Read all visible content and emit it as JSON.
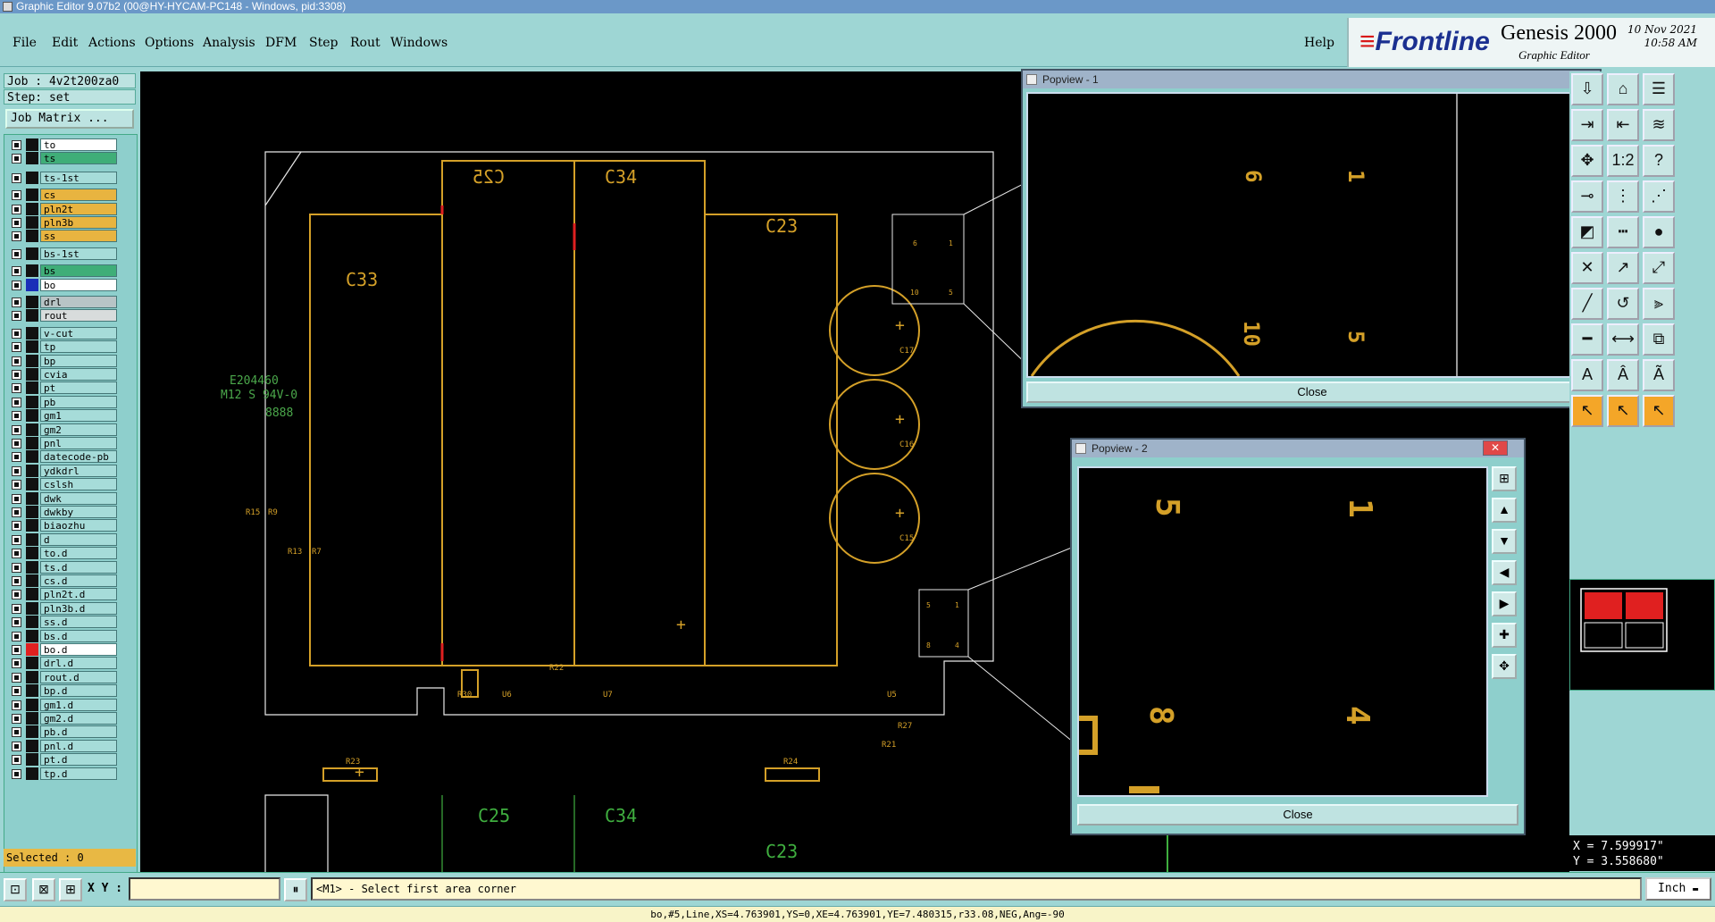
{
  "window_title": "Graphic Editor 9.07b2 (00@HY-HYCAM-PC148 - Windows, pid:3308)",
  "menu": [
    "File",
    "Edit",
    "Actions",
    "Options",
    "Analysis",
    "DFM",
    "Step",
    "Rout",
    "Windows"
  ],
  "help": "Help",
  "brand": {
    "logo": "Frontline",
    "product": "Genesis 2000",
    "subtitle": "Graphic Editor",
    "date": "10 Nov 2021",
    "time": "10:58 AM"
  },
  "job": {
    "job_line": "Job : 4v2t200za0",
    "step_line": "Step: set",
    "matrix_button": "Job Matrix ..."
  },
  "layers": [
    {
      "name": "to",
      "color": "#ffffff"
    },
    {
      "name": "ts",
      "color": "#3fae78"
    },
    {
      "name": "ts-1st",
      "color": "#a6dcd9"
    },
    {
      "name": "cs",
      "color": "#e8b440"
    },
    {
      "name": "pln2t",
      "color": "#e8b440"
    },
    {
      "name": "pln3b",
      "color": "#e8b440"
    },
    {
      "name": "ss",
      "color": "#e8b440"
    },
    {
      "name": "bs-1st",
      "color": "#a6dcd9"
    },
    {
      "name": "bs",
      "color": "#3fae78"
    },
    {
      "name": "bo",
      "color": "#ffffff"
    },
    {
      "name": "drl",
      "color": "#b8c4c6"
    },
    {
      "name": "rout",
      "color": "#d8dcdc"
    },
    {
      "name": "v-cut",
      "color": "#a6dcd9"
    },
    {
      "name": "tp",
      "color": "#a6dcd9"
    },
    {
      "name": "bp",
      "color": "#a6dcd9"
    },
    {
      "name": "cvia",
      "color": "#a6dcd9"
    },
    {
      "name": "pt",
      "color": "#a6dcd9"
    },
    {
      "name": "pb",
      "color": "#a6dcd9"
    },
    {
      "name": "gm1",
      "color": "#a6dcd9"
    },
    {
      "name": "gm2",
      "color": "#a6dcd9"
    },
    {
      "name": "pnl",
      "color": "#a6dcd9"
    },
    {
      "name": "datecode-pb",
      "color": "#a6dcd9"
    },
    {
      "name": "ydkdrl",
      "color": "#a6dcd9"
    },
    {
      "name": "cslsh",
      "color": "#a6dcd9"
    },
    {
      "name": "dwk",
      "color": "#a6dcd9"
    },
    {
      "name": "dwkby",
      "color": "#a6dcd9"
    },
    {
      "name": "biaozhu",
      "color": "#a6dcd9"
    },
    {
      "name": "d",
      "color": "#a6dcd9"
    },
    {
      "name": "to.d",
      "color": "#a6dcd9"
    },
    {
      "name": "ts.d",
      "color": "#a6dcd9"
    },
    {
      "name": "cs.d",
      "color": "#a6dcd9"
    },
    {
      "name": "pln2t.d",
      "color": "#a6dcd9"
    },
    {
      "name": "pln3b.d",
      "color": "#a6dcd9"
    },
    {
      "name": "ss.d",
      "color": "#a6dcd9"
    },
    {
      "name": "bs.d",
      "color": "#a6dcd9"
    },
    {
      "name": "bo.d",
      "color": "#ffffff"
    },
    {
      "name": "drl.d",
      "color": "#a6dcd9"
    },
    {
      "name": "rout.d",
      "color": "#a6dcd9"
    },
    {
      "name": "bp.d",
      "color": "#a6dcd9"
    },
    {
      "name": "gm1.d",
      "color": "#a6dcd9"
    },
    {
      "name": "gm2.d",
      "color": "#a6dcd9"
    },
    {
      "name": "pb.d",
      "color": "#a6dcd9"
    },
    {
      "name": "pnl.d",
      "color": "#a6dcd9"
    },
    {
      "name": "pt.d",
      "color": "#a6dcd9"
    },
    {
      "name": "tp.d",
      "color": "#a6dcd9"
    }
  ],
  "selected": "Selected : 0",
  "canvas_labels": {
    "c25": "C25",
    "c34": "C34",
    "c23": "C23",
    "c33": "C33",
    "code1": "E204460",
    "code2": "M12 S 94V-0",
    "code3": "8888",
    "r15": "R15",
    "r9": "R9",
    "r13": "R13",
    "r7": "R7",
    "r30": "R30",
    "r22": "R22",
    "r23": "R23",
    "r24": "R24",
    "r21": "R21",
    "r27": "R27",
    "c17": "C17",
    "c16": "C16",
    "c15": "C15",
    "u5": "U5",
    "u6": "U6",
    "u7": "U7",
    "pin6": "6",
    "pin1": "1",
    "pin10": "10",
    "pin5": "5",
    "pin8": "8",
    "pin4": "4",
    "plus": "+"
  },
  "popview1": {
    "title": "Popview - 1",
    "close": "Close",
    "labels": {
      "a": "6",
      "b": "1",
      "c": "10",
      "d": "5"
    }
  },
  "popview2": {
    "title": "Popview - 2",
    "close": "Close",
    "labels": {
      "a": "5",
      "b": "1",
      "c": "8",
      "d": "4"
    }
  },
  "coords": {
    "x": "X = 7.599917\"",
    "y": "Y = 3.558680\""
  },
  "xy_label": "X Y :",
  "xy_input": "",
  "prompt": "<M1> - Select first area corner",
  "units": "Inch",
  "status": "bo,#5,Line,XS=4.763901,YS=0,XE=4.763901,YE=7.480315,r33.08,NEG,Ang=-90",
  "colors": {
    "accent": "#9ed6d4",
    "silk": "#d4a028",
    "outline": "#ffffff",
    "green": "#3fae3f",
    "red": "#e02020"
  }
}
